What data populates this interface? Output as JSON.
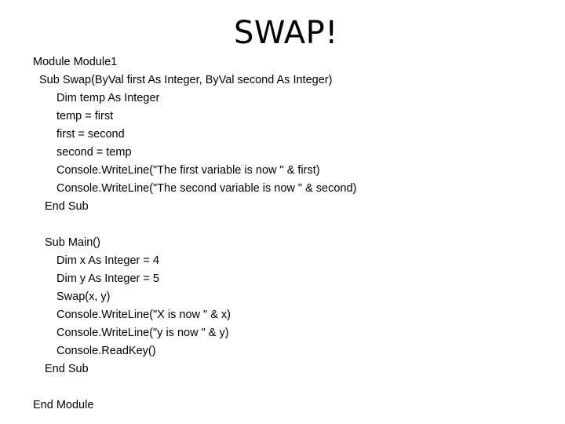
{
  "slide": {
    "title": "SWAP!",
    "code_lines": [
      {
        "indent": 0,
        "text": "Module Module1"
      },
      {
        "indent": 1,
        "text": "Sub Swap(ByVal first As Integer, ByVal second As Integer)"
      },
      {
        "indent": 3,
        "text": "Dim temp As Integer"
      },
      {
        "indent": 3,
        "text": "temp = first"
      },
      {
        "indent": 3,
        "text": "first = second"
      },
      {
        "indent": 3,
        "text": "second = temp"
      },
      {
        "indent": 3,
        "text": "Console.WriteLine(\"The first variable is now \" & first)"
      },
      {
        "indent": 3,
        "text": "Console.WriteLine(\"The second variable is now \" & second)"
      },
      {
        "indent": 2,
        "text": "End Sub"
      },
      {
        "indent": 0,
        "text": ""
      },
      {
        "indent": 2,
        "text": "Sub Main()"
      },
      {
        "indent": 3,
        "text": "Dim x As Integer = 4"
      },
      {
        "indent": 3,
        "text": "Dim y As Integer = 5"
      },
      {
        "indent": 3,
        "text": "Swap(x, y)"
      },
      {
        "indent": 3,
        "text": "Console.WriteLine(\"X is now \" & x)"
      },
      {
        "indent": 3,
        "text": "Console.WriteLine(\"y is now \" & y)"
      },
      {
        "indent": 3,
        "text": "Console.ReadKey()"
      },
      {
        "indent": 2,
        "text": "End Sub"
      },
      {
        "indent": 0,
        "text": ""
      },
      {
        "indent": 0,
        "text": "End Module"
      }
    ]
  }
}
